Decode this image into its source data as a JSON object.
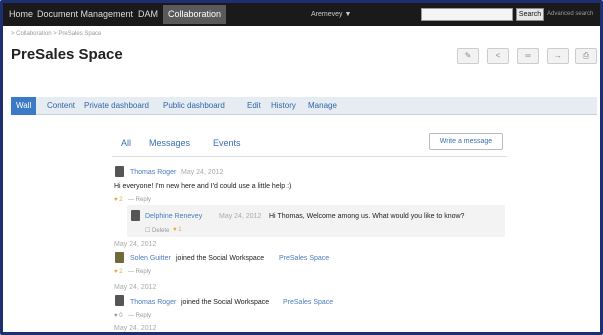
{
  "topbar": {
    "nav": [
      "Home",
      "Document Management",
      "DAM",
      "Collaboration"
    ],
    "user": "Aremevey ▼",
    "search_placeholder": "",
    "search_label": "Search",
    "advanced_search": "Advanced search"
  },
  "breadcrumb": "> Collaboration > PreSales Space",
  "page_title": "PreSales Space",
  "toolbar_icons": [
    "edit-icon",
    "share-icon",
    "glasses-icon",
    "arrow-icon",
    "print-icon"
  ],
  "tabs": [
    "Wall",
    "Content",
    "Private dashboard",
    "Public dashboard",
    "Edit",
    "History",
    "Manage"
  ],
  "stream_tabs": [
    "All",
    "Messages",
    "Events"
  ],
  "write_label": "Write a message",
  "posts": [
    {
      "author": "Thomas Roger",
      "date": "May 24, 2012",
      "text": "Hi everyone! I'm new here and I'd could use a little help :)",
      "likes": "♥ 2",
      "reply": "— Reply"
    },
    {
      "author": "Delphine Renevey",
      "date": "May 24, 2012",
      "text": "Hi Thomas, Welcome among us. What would you like to know?",
      "actions": "☐ Delete",
      "likes": "♥ 1"
    }
  ],
  "events": [
    {
      "date": "May 24, 2012",
      "author": "Solen Guitter",
      "text": "joined the Social Workspace",
      "link": "PreSales Space",
      "likes": "♥ 2",
      "reply": "— Reply"
    },
    {
      "date": "May 24, 2012",
      "author": "Thomas Roger",
      "text": "joined the Social Workspace",
      "link": "PreSales Space",
      "likes": "♥ 0",
      "reply": "— Reply"
    }
  ],
  "last_date": "May 24, 2012",
  "colors": {
    "topbar": "#1a1a1a",
    "accent": "#3b7ac4",
    "link": "#4a7bbd",
    "heart": "#e8a33a"
  }
}
